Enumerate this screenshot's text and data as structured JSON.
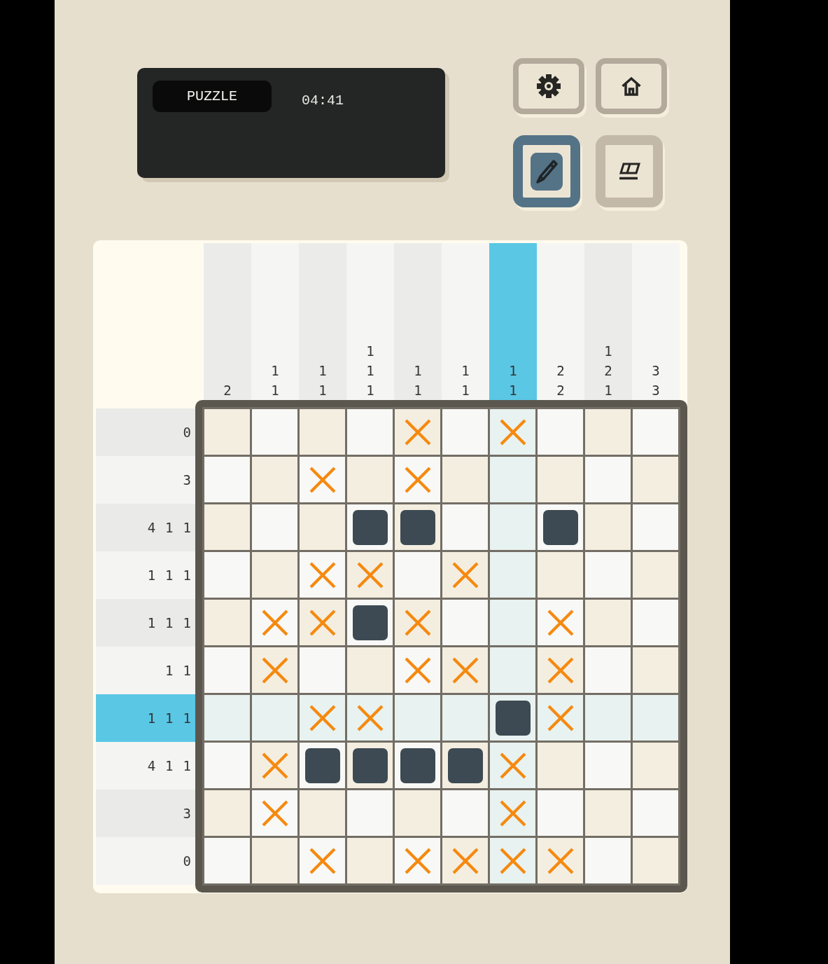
{
  "status_panel": {
    "mode_label": "PUZZLE",
    "timer": "04:41"
  },
  "menu_buttons": [
    {
      "kind": "settings"
    },
    {
      "kind": "home"
    }
  ],
  "tools": [
    {
      "kind": "pencil",
      "selected": true
    },
    {
      "kind": "eraser",
      "selected": false
    }
  ],
  "column_clues": [
    {
      "numbers": [
        "2"
      ],
      "selected": false
    },
    {
      "numbers": [
        "1",
        "1"
      ],
      "selected": false
    },
    {
      "numbers": [
        "1",
        "1"
      ],
      "selected": false
    },
    {
      "numbers": [
        "1",
        "1",
        "1"
      ],
      "selected": false
    },
    {
      "numbers": [
        "1",
        "1"
      ],
      "selected": false
    },
    {
      "numbers": [
        "1",
        "1"
      ],
      "selected": false
    },
    {
      "numbers": [
        "1",
        "1"
      ],
      "selected": true
    },
    {
      "numbers": [
        "2",
        "2"
      ],
      "selected": false
    },
    {
      "numbers": [
        "1",
        "2",
        "1"
      ],
      "selected": false
    },
    {
      "numbers": [
        "3",
        "3"
      ],
      "selected": false
    }
  ],
  "row_clues": [
    {
      "numbers": [
        "0"
      ],
      "selected": false
    },
    {
      "numbers": [
        "3"
      ],
      "selected": false
    },
    {
      "numbers": [
        "4",
        "1",
        "1"
      ],
      "selected": false
    },
    {
      "numbers": [
        "1",
        "1",
        "1"
      ],
      "selected": false
    },
    {
      "numbers": [
        "1",
        "1",
        "1"
      ],
      "selected": false
    },
    {
      "numbers": [
        "1",
        "1"
      ],
      "selected": false
    },
    {
      "numbers": [
        "1",
        "1",
        "1"
      ],
      "selected": true
    },
    {
      "numbers": [
        "4",
        "1",
        "1"
      ],
      "selected": false
    },
    {
      "numbers": [
        "3"
      ],
      "selected": false
    },
    {
      "numbers": [
        "0"
      ],
      "selected": false
    }
  ],
  "grid": {
    "rows": [
      {
        "cells": [
          {
            "kind": "empty"
          },
          {
            "kind": "empty"
          },
          {
            "kind": "empty"
          },
          {
            "kind": "empty"
          },
          {
            "kind": "crossed"
          },
          {
            "kind": "empty"
          },
          {
            "kind": "crossed"
          },
          {
            "kind": "empty"
          },
          {
            "kind": "empty"
          },
          {
            "kind": "empty"
          }
        ]
      },
      {
        "cells": [
          {
            "kind": "empty"
          },
          {
            "kind": "empty"
          },
          {
            "kind": "crossed"
          },
          {
            "kind": "empty"
          },
          {
            "kind": "crossed"
          },
          {
            "kind": "empty"
          },
          {
            "kind": "empty"
          },
          {
            "kind": "empty"
          },
          {
            "kind": "empty"
          },
          {
            "kind": "empty"
          }
        ]
      },
      {
        "cells": [
          {
            "kind": "empty"
          },
          {
            "kind": "empty"
          },
          {
            "kind": "empty"
          },
          {
            "kind": "filled"
          },
          {
            "kind": "filled"
          },
          {
            "kind": "empty"
          },
          {
            "kind": "empty"
          },
          {
            "kind": "filled"
          },
          {
            "kind": "empty"
          },
          {
            "kind": "empty"
          }
        ]
      },
      {
        "cells": [
          {
            "kind": "empty"
          },
          {
            "kind": "empty"
          },
          {
            "kind": "crossed"
          },
          {
            "kind": "crossed"
          },
          {
            "kind": "empty"
          },
          {
            "kind": "crossed"
          },
          {
            "kind": "empty"
          },
          {
            "kind": "empty"
          },
          {
            "kind": "empty"
          },
          {
            "kind": "empty"
          }
        ]
      },
      {
        "cells": [
          {
            "kind": "empty"
          },
          {
            "kind": "crossed"
          },
          {
            "kind": "crossed"
          },
          {
            "kind": "filled"
          },
          {
            "kind": "crossed"
          },
          {
            "kind": "empty"
          },
          {
            "kind": "empty"
          },
          {
            "kind": "crossed"
          },
          {
            "kind": "empty"
          },
          {
            "kind": "empty"
          }
        ]
      },
      {
        "cells": [
          {
            "kind": "empty"
          },
          {
            "kind": "crossed"
          },
          {
            "kind": "empty"
          },
          {
            "kind": "empty"
          },
          {
            "kind": "crossed"
          },
          {
            "kind": "crossed"
          },
          {
            "kind": "empty"
          },
          {
            "kind": "crossed"
          },
          {
            "kind": "empty"
          },
          {
            "kind": "empty"
          }
        ]
      },
      {
        "cells": [
          {
            "kind": "empty"
          },
          {
            "kind": "empty"
          },
          {
            "kind": "crossed"
          },
          {
            "kind": "crossed"
          },
          {
            "kind": "empty"
          },
          {
            "kind": "empty"
          },
          {
            "kind": "filled"
          },
          {
            "kind": "crossed"
          },
          {
            "kind": "empty"
          },
          {
            "kind": "empty"
          }
        ]
      },
      {
        "cells": [
          {
            "kind": "empty"
          },
          {
            "kind": "crossed"
          },
          {
            "kind": "filled"
          },
          {
            "kind": "filled"
          },
          {
            "kind": "filled"
          },
          {
            "kind": "filled"
          },
          {
            "kind": "crossed"
          },
          {
            "kind": "empty"
          },
          {
            "kind": "empty"
          },
          {
            "kind": "empty"
          }
        ]
      },
      {
        "cells": [
          {
            "kind": "empty"
          },
          {
            "kind": "crossed"
          },
          {
            "kind": "empty"
          },
          {
            "kind": "empty"
          },
          {
            "kind": "empty"
          },
          {
            "kind": "empty"
          },
          {
            "kind": "crossed"
          },
          {
            "kind": "empty"
          },
          {
            "kind": "empty"
          },
          {
            "kind": "empty"
          }
        ]
      },
      {
        "cells": [
          {
            "kind": "empty"
          },
          {
            "kind": "empty"
          },
          {
            "kind": "crossed"
          },
          {
            "kind": "empty"
          },
          {
            "kind": "crossed"
          },
          {
            "kind": "crossed"
          },
          {
            "kind": "crossed"
          },
          {
            "kind": "crossed"
          },
          {
            "kind": "empty"
          },
          {
            "kind": "empty"
          }
        ]
      }
    ]
  }
}
